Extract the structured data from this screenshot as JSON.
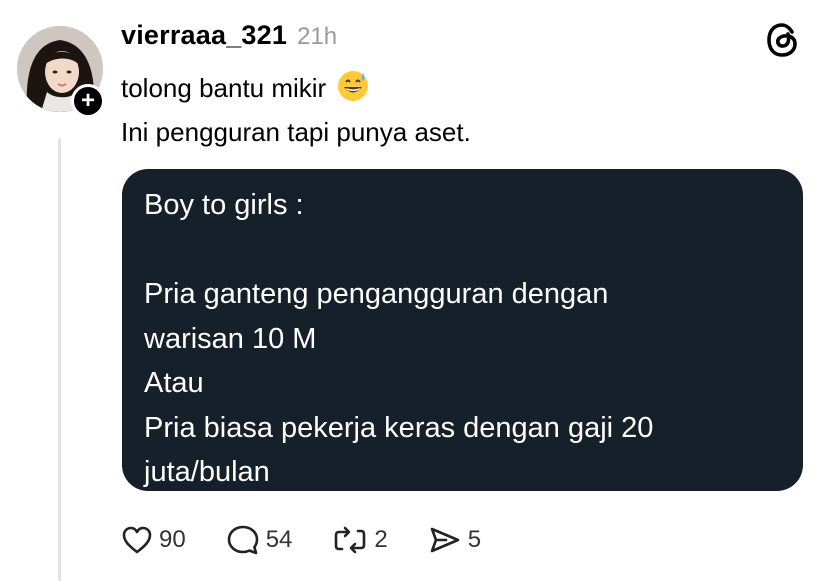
{
  "post": {
    "username": "vierraaa_321",
    "timestamp": "21h",
    "text_line1": "tolong bantu mikir",
    "text_line1_emoji": "grinning-face-with-sweat-emoji",
    "text_line2": "Ini pengguran tapi punya aset."
  },
  "quote": {
    "lines": [
      "Boy to girls :",
      "",
      "Pria ganteng pengangguran dengan",
      "warisan 10 M",
      "Atau",
      "Pria biasa pekerja keras dengan gaji 20",
      "juta/bulan"
    ]
  },
  "actions": {
    "like_count": "90",
    "comment_count": "54",
    "repost_count": "2",
    "share_count": "5"
  },
  "icons": {
    "like": "heart-icon",
    "comment": "comment-bubble-icon",
    "repost": "repost-icon",
    "share": "send-icon",
    "app": "threads-logo-icon",
    "follow": "plus-icon"
  },
  "colors": {
    "card_background": "#16202a",
    "card_text": "#ffffff",
    "muted_text": "#9a9a9a",
    "thread_line": "#e3e3e3"
  }
}
